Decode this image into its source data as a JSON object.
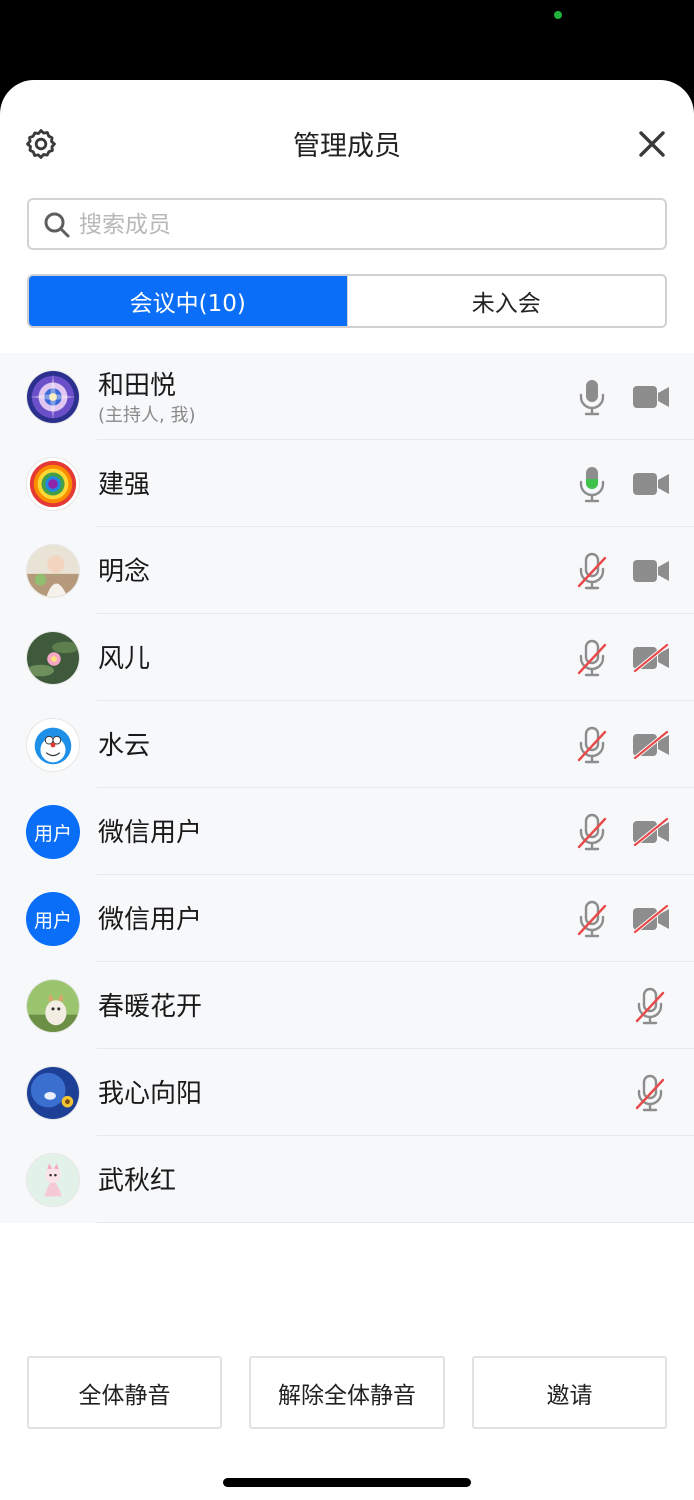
{
  "header": {
    "title": "管理成员"
  },
  "search": {
    "placeholder": "搜索成员"
  },
  "tabs": [
    {
      "label": "会议中(10)",
      "active": true
    },
    {
      "label": "未入会",
      "active": false
    }
  ],
  "members": [
    {
      "name": "和田悦",
      "sub": "(主持人, 我)",
      "mic": "on",
      "cam": "on"
    },
    {
      "name": "建强",
      "mic": "speaking",
      "cam": "on"
    },
    {
      "name": "明念",
      "mic": "muted",
      "cam": "on"
    },
    {
      "name": "风儿",
      "mic": "muted",
      "cam": "off"
    },
    {
      "name": "水云",
      "mic": "muted",
      "cam": "off"
    },
    {
      "name": "微信用户",
      "avatar_text": "用户",
      "mic": "muted",
      "cam": "off"
    },
    {
      "name": "微信用户",
      "avatar_text": "用户",
      "mic": "muted",
      "cam": "off"
    },
    {
      "name": "春暖花开",
      "mic": "muted",
      "cam": "none"
    },
    {
      "name": "我心向阳",
      "mic": "muted",
      "cam": "none"
    },
    {
      "name": "武秋红",
      "mic": "none",
      "cam": "none"
    }
  ],
  "footer": {
    "mute_all": "全体静音",
    "unmute_all": "解除全体静音",
    "invite": "邀请"
  },
  "colors": {
    "accent": "#0a6ef8",
    "speaking": "#3ec24a",
    "muted_slash": "#e84a4a",
    "icon": "#8d8d8d"
  }
}
